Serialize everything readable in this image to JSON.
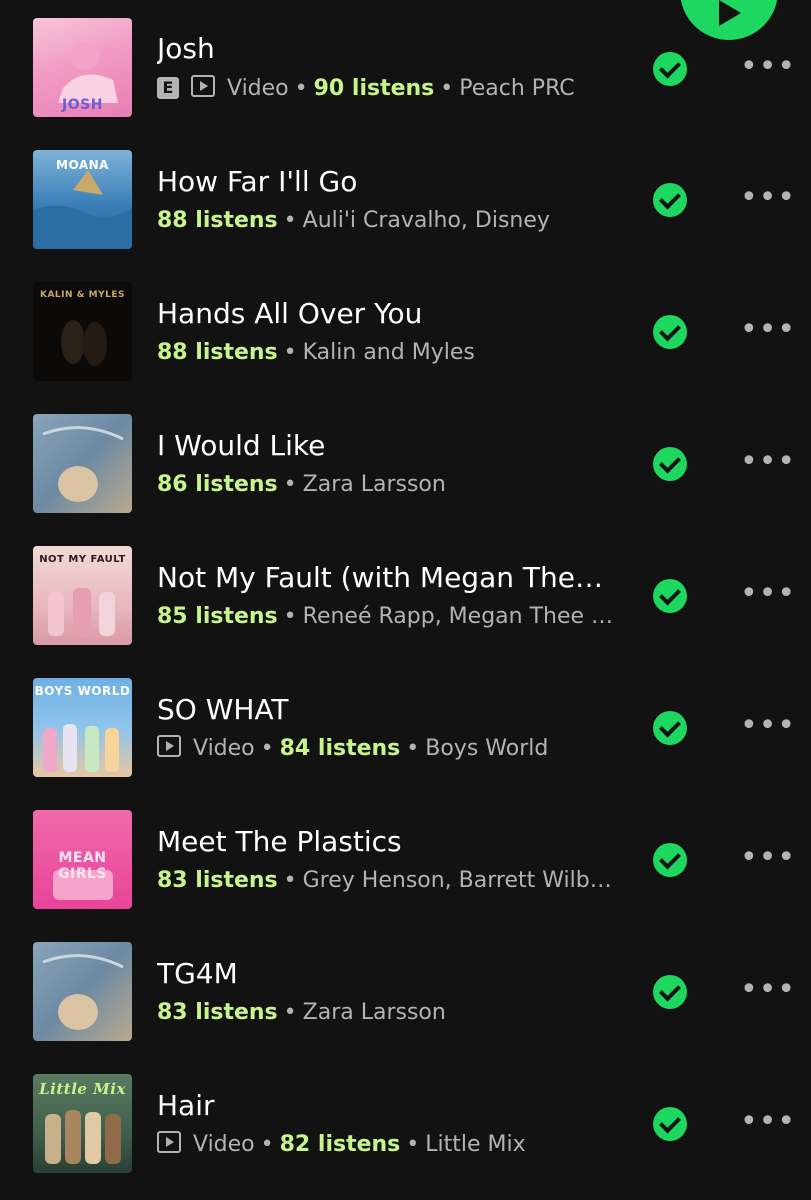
{
  "play_button": {
    "icon": "play-icon",
    "color": "#1ed760"
  },
  "colors": {
    "background": "#121212",
    "accent": "#1ed760",
    "listens": "#c7f58c",
    "secondary_text": "#b3b3b3"
  },
  "tracks": [
    {
      "title": "Josh",
      "explicit": "E",
      "video_label": "Video",
      "listens": "90 listens",
      "artists": "Peach PRC",
      "art_caption": "JOSH"
    },
    {
      "title": "How Far I'll Go",
      "listens": "88 listens",
      "artists": "Auli'i Cravalho, Disney",
      "art_caption": "MOANA"
    },
    {
      "title": "Hands All Over You",
      "listens": "88 listens",
      "artists": "Kalin and Myles",
      "art_caption": "KALIN & MYLES"
    },
    {
      "title": "I Would Like",
      "listens": "86 listens",
      "artists": "Zara Larsson",
      "art_caption": ""
    },
    {
      "title": "Not My Fault (with Megan Thee Stallion)",
      "listens": "85 listens",
      "artists": "Reneé Rapp, Megan Thee Stallion",
      "art_caption": "NOT MY FAULT"
    },
    {
      "title": "SO WHAT",
      "video_label": "Video",
      "listens": "84 listens",
      "artists": "Boys World",
      "art_caption": "BOYS WORLD"
    },
    {
      "title": "Meet The Plastics",
      "listens": "83 listens",
      "artists": "Grey Henson, Barrett Wilbert Weed",
      "art_caption": "MEAN GIRLS"
    },
    {
      "title": "TG4M",
      "listens": "83 listens",
      "artists": "Zara Larsson",
      "art_caption": ""
    },
    {
      "title": "Hair",
      "video_label": "Video",
      "listens": "82 listens",
      "artists": "Little Mix",
      "art_caption": "Little Mix"
    }
  ],
  "icons": {
    "downloaded": "check-circle-icon",
    "more": "more-options-icon",
    "video": "video-icon",
    "explicit": "explicit-badge"
  },
  "separator": "•",
  "more_glyph": "•••"
}
